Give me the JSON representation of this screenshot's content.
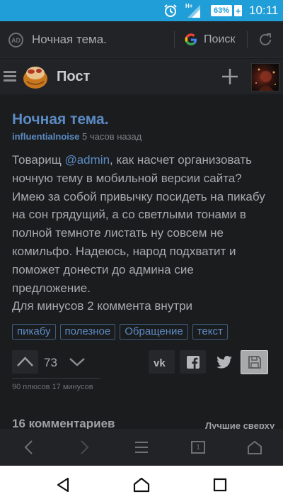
{
  "status_bar": {
    "network": "H+",
    "battery": "63%",
    "time": "10:11"
  },
  "browser": {
    "page_title": "Ночная тема.",
    "search_label": "Поиск",
    "tab_count": "1"
  },
  "site_header": {
    "section_title": "Пост"
  },
  "post": {
    "title": "Ночная тема.",
    "author": "influentialnoise",
    "time_ago": "5 часов назад",
    "body_prefix": "Товарищ ",
    "mention": "@admin",
    "body_main": ", как насчет организовать ночную тему в мобильной версии сайта? Имею за собой привычку посидеть на пикабу на сон грядущий, а со светлыми тонами в полной темноте листать ну совсем не комильфо. Надеюсь, народ подхватит и поможет донести до админа сие предложение.",
    "body_last": "Для минусов 2 коммента внутри",
    "tags": [
      "пикабу",
      "полезное",
      "Обращение",
      "текст"
    ],
    "rating": "73",
    "rating_stats": "90 плюсов 17 минусов"
  },
  "comments": {
    "title": "16 комментариев",
    "sort_label": "Лучшие сверху"
  },
  "colors": {
    "status_bar": "#1f9ed8",
    "background": "#1b1c1e",
    "link": "#5b8bc4",
    "text": "#a7a9ad"
  },
  "icons": [
    "alarm-icon",
    "signal-icon",
    "battery-icon",
    "ad-block-icon",
    "google-icon",
    "reload-icon",
    "hamburger-icon",
    "pikabu-logo",
    "plus-icon",
    "user-avatar",
    "arrow-up-icon",
    "arrow-down-icon",
    "vk-icon",
    "facebook-icon",
    "twitter-icon",
    "save-icon",
    "back-icon",
    "forward-icon",
    "menu-icon",
    "tabs-icon",
    "home-icon",
    "nav-back-icon",
    "nav-home-icon",
    "nav-recent-icon"
  ]
}
